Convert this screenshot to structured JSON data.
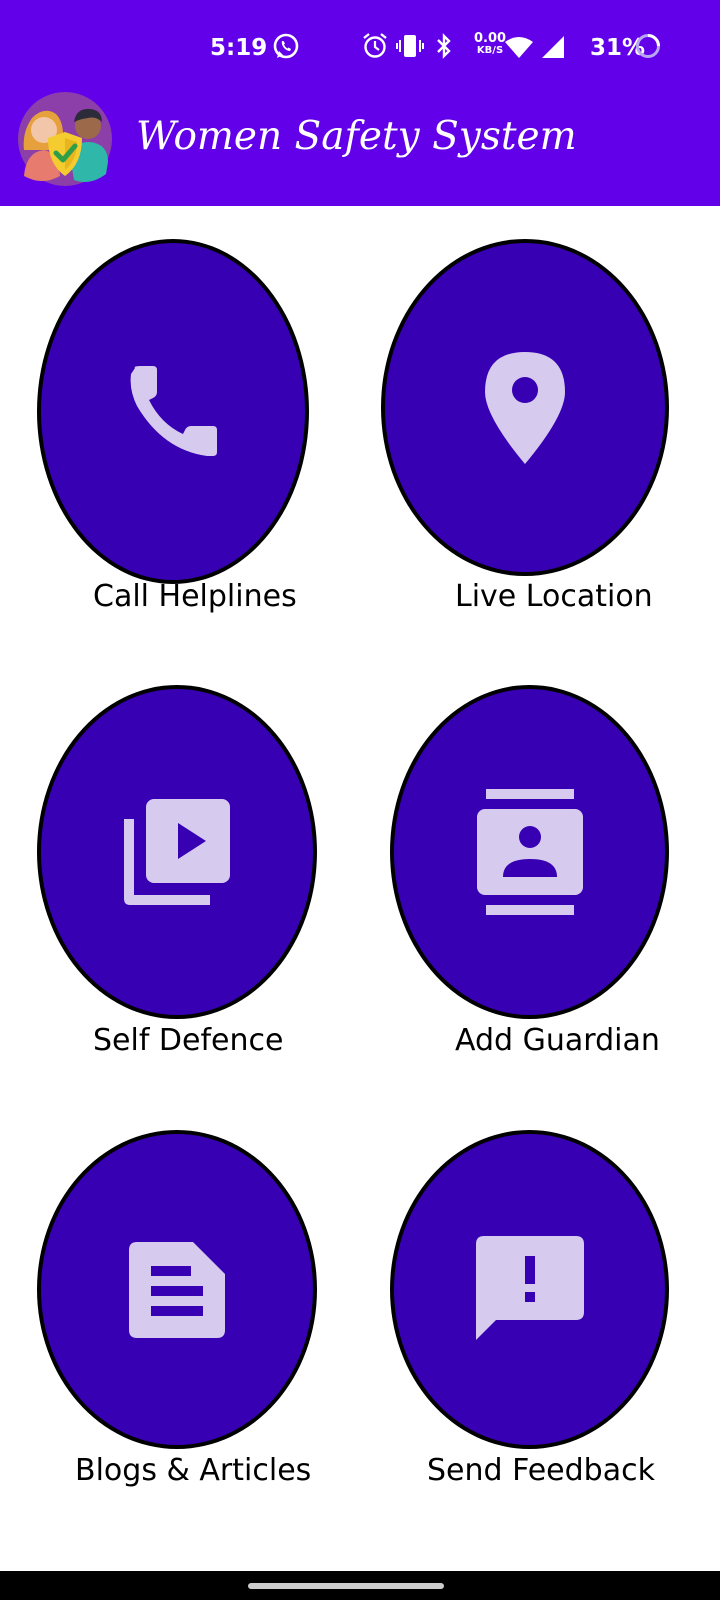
{
  "status_bar": {
    "time": "5:19",
    "net_speed_value": "0.00",
    "net_speed_unit": "KB/S",
    "battery_percent": "31%"
  },
  "app_bar": {
    "title": "Women Safety System",
    "background_color": "#6200ea"
  },
  "tiles": [
    {
      "label": "Call Helplines",
      "icon": "phone-icon"
    },
    {
      "label": "Live Location",
      "icon": "location-pin-icon"
    },
    {
      "label": "Self Defence",
      "icon": "video-library-icon"
    },
    {
      "label": "Add Guardian",
      "icon": "contacts-icon"
    },
    {
      "label": "Blogs & Articles",
      "icon": "article-icon"
    },
    {
      "label": "Send Feedback",
      "icon": "feedback-icon"
    }
  ],
  "colors": {
    "tile_fill": "#3700b3",
    "icon_fill": "#d6cbef"
  }
}
